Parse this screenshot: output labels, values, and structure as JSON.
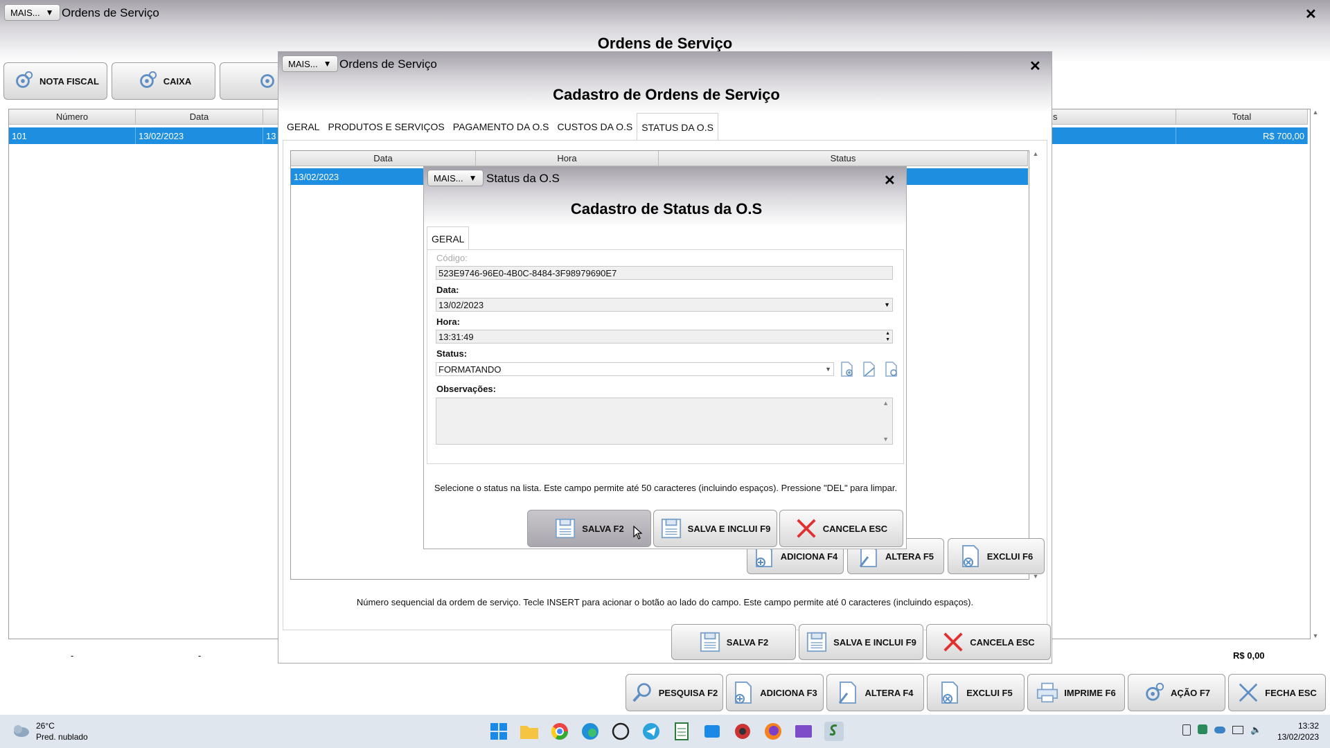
{
  "main": {
    "mais": "MAIS...",
    "title": "Ordens de Serviço",
    "heading": "Ordens de Serviço",
    "close": "✕",
    "top_buttons": [
      {
        "label": "NOTA FISCAL"
      },
      {
        "label": "CAIXA"
      }
    ],
    "grid": {
      "headers": [
        "Número",
        "Data",
        "s",
        "Total"
      ],
      "row": {
        "numero": "101",
        "data": "13/02/2023",
        "partial": "13",
        "total": "R$ 700,00"
      }
    },
    "footer": {
      "dash1": "-",
      "dash2": "-",
      "total": "R$ 0,00"
    },
    "bottom_buttons": [
      "PESQUISA F2",
      "ADICIONA F3",
      "ALTERA F4",
      "EXCLUI F5",
      "IMPRIME F6",
      "AÇÃO F7",
      "FECHA ESC"
    ]
  },
  "cadastro_os": {
    "mais": "MAIS...",
    "title": "Ordens de Serviço",
    "close": "✕",
    "heading": "Cadastro de Ordens de Serviço",
    "tabs": [
      "GERAL",
      "PRODUTOS E SERVIÇOS",
      "PAGAMENTO DA O.S",
      "CUSTOS DA O.S",
      "STATUS DA O.S"
    ],
    "grid": {
      "headers": [
        "Data",
        "Hora",
        "Status"
      ],
      "row": {
        "data": "13/02/2023"
      }
    },
    "list_buttons": [
      "ADICIONA F4",
      "ALTERA F5",
      "EXCLUI F6"
    ],
    "hint": "Número sequencial da ordem de serviço. Tecle INSERT para acionar o botão ao lado do campo. Este campo permite até 0 caracteres (incluindo espaços).",
    "buttons": [
      "SALVA F2",
      "SALVA E INCLUI F9",
      "CANCELA ESC"
    ]
  },
  "status_dialog": {
    "mais": "MAIS...",
    "title": "Status da O.S",
    "close": "✕",
    "heading": "Cadastro de Status da O.S",
    "tab": "GERAL",
    "codigo_label": "Código:",
    "codigo_value": "523E9746-96E0-4B0C-8484-3F98979690E7",
    "data_label": "Data:",
    "data_value": "13/02/2023",
    "hora_label": "Hora:",
    "hora_value": "13:31:49",
    "status_label": "Status:",
    "status_value": "FORMATANDO",
    "obs_label": "Observações:",
    "hint": "Selecione o status na lista. Este campo permite até 50 caracteres (incluindo espaços). Pressione \"DEL\" para limpar.",
    "buttons": [
      "SALVA F2",
      "SALVA E INCLUI F9",
      "CANCELA ESC"
    ]
  },
  "taskbar": {
    "temp": "26°C",
    "weather": "Pred. nublado",
    "time": "13:32",
    "date": "13/02/2023"
  }
}
